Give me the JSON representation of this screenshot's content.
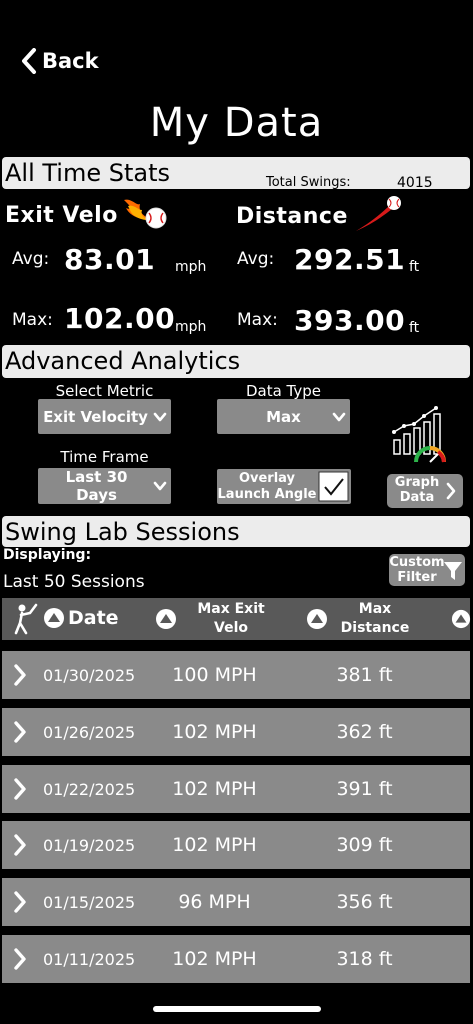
{
  "nav": {
    "back_label": "Back"
  },
  "page": {
    "title": "My Data"
  },
  "all_time": {
    "section_title": "All Time Stats",
    "total_swings_label": "Total Swings:",
    "total_swings_value": "4015",
    "exit_velo": {
      "title": "Exit Velo",
      "avg_label": "Avg:",
      "avg_value": "83.01",
      "avg_unit": "mph",
      "max_label": "Max:",
      "max_value": "102.00",
      "max_unit": "mph"
    },
    "distance": {
      "title": "Distance",
      "avg_label": "Avg:",
      "avg_value": "292.51",
      "avg_unit": "ft",
      "max_label": "Max:",
      "max_value": "393.00",
      "max_unit": "ft"
    }
  },
  "advanced": {
    "section_title": "Advanced Analytics",
    "select_metric_label": "Select Metric",
    "select_metric_value": "Exit Velocity",
    "data_type_label": "Data Type",
    "data_type_value": "Max",
    "time_frame_label": "Time Frame",
    "time_frame_value": "Last 30 Days",
    "overlay_label": "Overlay Launch Angle",
    "overlay_checked": true,
    "graph_button": "Graph Data"
  },
  "sessions": {
    "section_title": "Swing Lab Sessions",
    "displaying_label": "Displaying:",
    "displaying_value": "Last 50 Sessions",
    "custom_filter_label": "Custom Filter",
    "columns": {
      "date": "Date",
      "max_exit_velo": "Max Exit Velo",
      "max_distance": "Max Distance"
    },
    "rows": [
      {
        "date": "01/30/2025",
        "velo": "100 MPH",
        "dist": "381 ft"
      },
      {
        "date": "01/26/2025",
        "velo": "102 MPH",
        "dist": "362 ft"
      },
      {
        "date": "01/22/2025",
        "velo": "102 MPH",
        "dist": "391 ft"
      },
      {
        "date": "01/19/2025",
        "velo": "102 MPH",
        "dist": "309 ft"
      },
      {
        "date": "01/15/2025",
        "velo": "96 MPH",
        "dist": "356 ft"
      },
      {
        "date": "01/11/2025",
        "velo": "102 MPH",
        "dist": "318 ft"
      }
    ]
  },
  "colors": {
    "background": "#000000",
    "section_bar": "#ececec",
    "control_gray": "#8a8a8a",
    "header_gray": "#595959",
    "fire_orange": "#ff6a00",
    "ball_red": "#d61a1a"
  },
  "icons": {
    "back": "chevron-left-icon",
    "exit_velo": "flaming-baseball-icon",
    "distance": "flying-baseball-icon",
    "graph": "chart-gauge-icon",
    "batter": "batter-icon",
    "sort": "sort-up-icon",
    "row": "chevron-right-icon",
    "filter": "funnel-icon"
  }
}
